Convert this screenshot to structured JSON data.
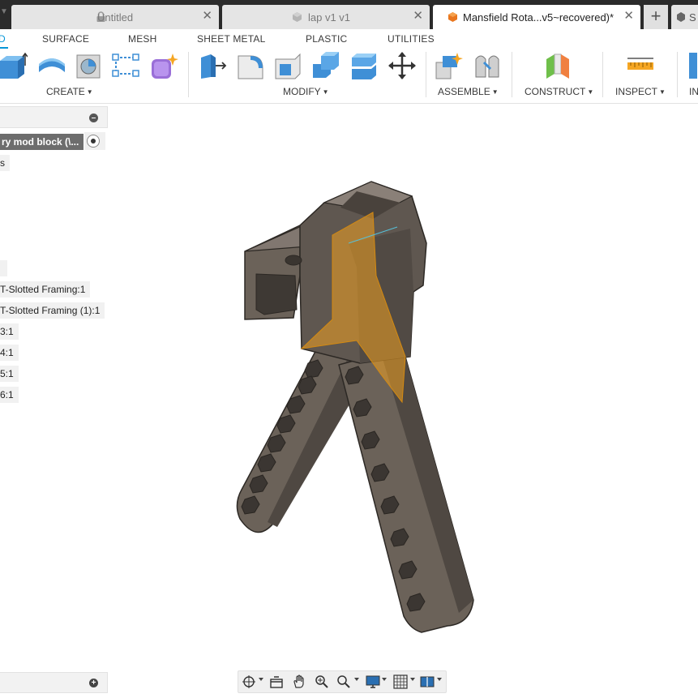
{
  "tabs": [
    {
      "label": "Untitled",
      "icon": "lock-icon",
      "active": false
    },
    {
      "label": "lap v1 v1",
      "icon": "cube-icon",
      "active": false
    },
    {
      "label": "Mansfield Rota...v5~recovered)*",
      "icon": "orange-cube-icon",
      "active": true
    }
  ],
  "right_tab_label": "S",
  "ribbon": {
    "tabs": [
      "D",
      "SURFACE",
      "MESH",
      "SHEET METAL",
      "PLASTIC",
      "UTILITIES"
    ],
    "active_tab": "D",
    "groups": [
      {
        "label": "CREATE",
        "tools": [
          "extrude-icon",
          "revolve-icon",
          "hole-icon",
          "sketch-icon",
          "form-icon"
        ]
      },
      {
        "label": "MODIFY",
        "tools": [
          "press-pull-icon",
          "fillet-icon",
          "shell-icon",
          "combine-icon",
          "offset-face-icon",
          "move-icon"
        ]
      },
      {
        "label": "ASSEMBLE",
        "tools": [
          "new-component-icon",
          "joint-icon"
        ]
      },
      {
        "label": "CONSTRUCT",
        "tools": [
          "plane-icon"
        ]
      },
      {
        "label": "INSPECT",
        "tools": [
          "measure-icon"
        ]
      },
      {
        "label": "IN",
        "tools": []
      }
    ],
    "accent": "#0696d7"
  },
  "browser": {
    "root": "ry mod block (\\...",
    "nodes": [
      "s",
      "",
      "T-Slotted Framing:1",
      "T-Slotted Framing (1):1",
      "3:1",
      "4:1",
      "5:1",
      "6:1"
    ]
  },
  "nav_bar": {
    "tools": [
      "orbit-icon",
      "look-at-icon",
      "pan-icon",
      "zoom-icon",
      "fit-icon",
      "display-icon",
      "grid-icon",
      "viewports-icon"
    ]
  },
  "colors": {
    "model_body": "#6b6259",
    "plane_highlight": "#f0a020",
    "tab_bar": "#2b2b2b"
  }
}
